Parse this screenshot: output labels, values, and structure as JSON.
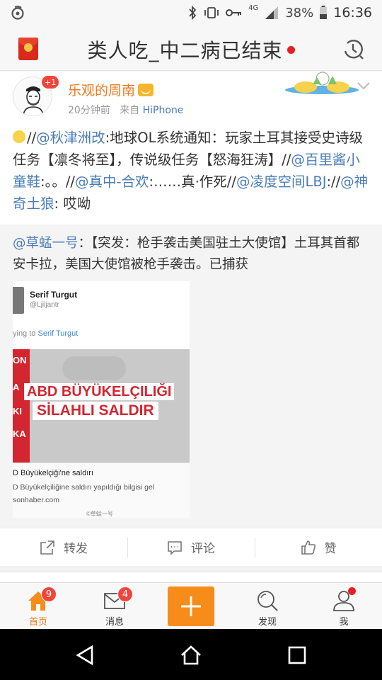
{
  "status_bar": {
    "network": "4G",
    "battery": "38%",
    "time": "16:36"
  },
  "header": {
    "title": "类人吃_中二病已结束",
    "left_icon": "red-packet-icon",
    "right_icon": "history-clock-icon"
  },
  "post": {
    "avatar_badge": "+1",
    "username": "乐观的周南",
    "time_ago": "20分钟前",
    "source_prefix": "来自",
    "source": "HiPhone",
    "text": [
      {
        "t": "//",
        "m": false
      },
      {
        "t": "@秋津洲改",
        "m": true
      },
      {
        "t": ":地球OL系统通知：玩家土耳其接受史诗级任务【凛冬将至】，传说级任务【怒海狂涛】//",
        "m": false
      },
      {
        "t": "@百里酱小童鞋",
        "m": true
      },
      {
        "t": ":。。//",
        "m": false
      },
      {
        "t": "@真中-合欢",
        "m": true
      },
      {
        "t": ":……真·作死//",
        "m": false
      },
      {
        "t": "@凌度空间LBJ",
        "m": true
      },
      {
        "t": "://",
        "m": false
      },
      {
        "t": "@神奇土狼",
        "m": true
      },
      {
        "t": ": 哎呦",
        "m": false
      }
    ],
    "repost": {
      "author": "@草蜢一号",
      "text": "：【突发：枪手袭击美国驻土大使馆】土耳其首都安卡拉，美国大使馆被枪手袭击。已捕获",
      "image": {
        "name": "Serif Turgut",
        "handle": "@Ljiljantr",
        "reply_prefix": "ying to",
        "reply_name": "Serif Turgut",
        "side_letters": [
          "ON",
          "A",
          "KI",
          "KA"
        ],
        "banner1": "ABD BÜYÜKELÇILIĞI",
        "banner2": "SİLAHLI SALDIR",
        "caption1": "D Büyükelçiği'ne saldırı",
        "caption2": "D Büyükelçiliğine saldırı yapıldığı bilgisi gel",
        "caption3": "sonhaber.com",
        "watermark": "©草蜢一号"
      }
    },
    "actions": [
      {
        "icon": "share-icon",
        "label": "转发"
      },
      {
        "icon": "comment-icon",
        "label": "评论"
      },
      {
        "icon": "thumbs-up-icon",
        "label": "赞"
      }
    ]
  },
  "tabs": [
    {
      "icon": "home-icon",
      "label": "首页",
      "badge": "9",
      "active": true
    },
    {
      "icon": "mail-icon",
      "label": "消息",
      "badge": "4"
    },
    {
      "icon": "plus-icon",
      "label": ""
    },
    {
      "icon": "search-icon",
      "label": "发现"
    },
    {
      "icon": "person-icon",
      "label": "我",
      "dot": true
    }
  ],
  "colors": {
    "accent": "#f78c1a",
    "mention": "#4a7db8",
    "username": "#f07a1c",
    "badge": "#f0453b"
  }
}
